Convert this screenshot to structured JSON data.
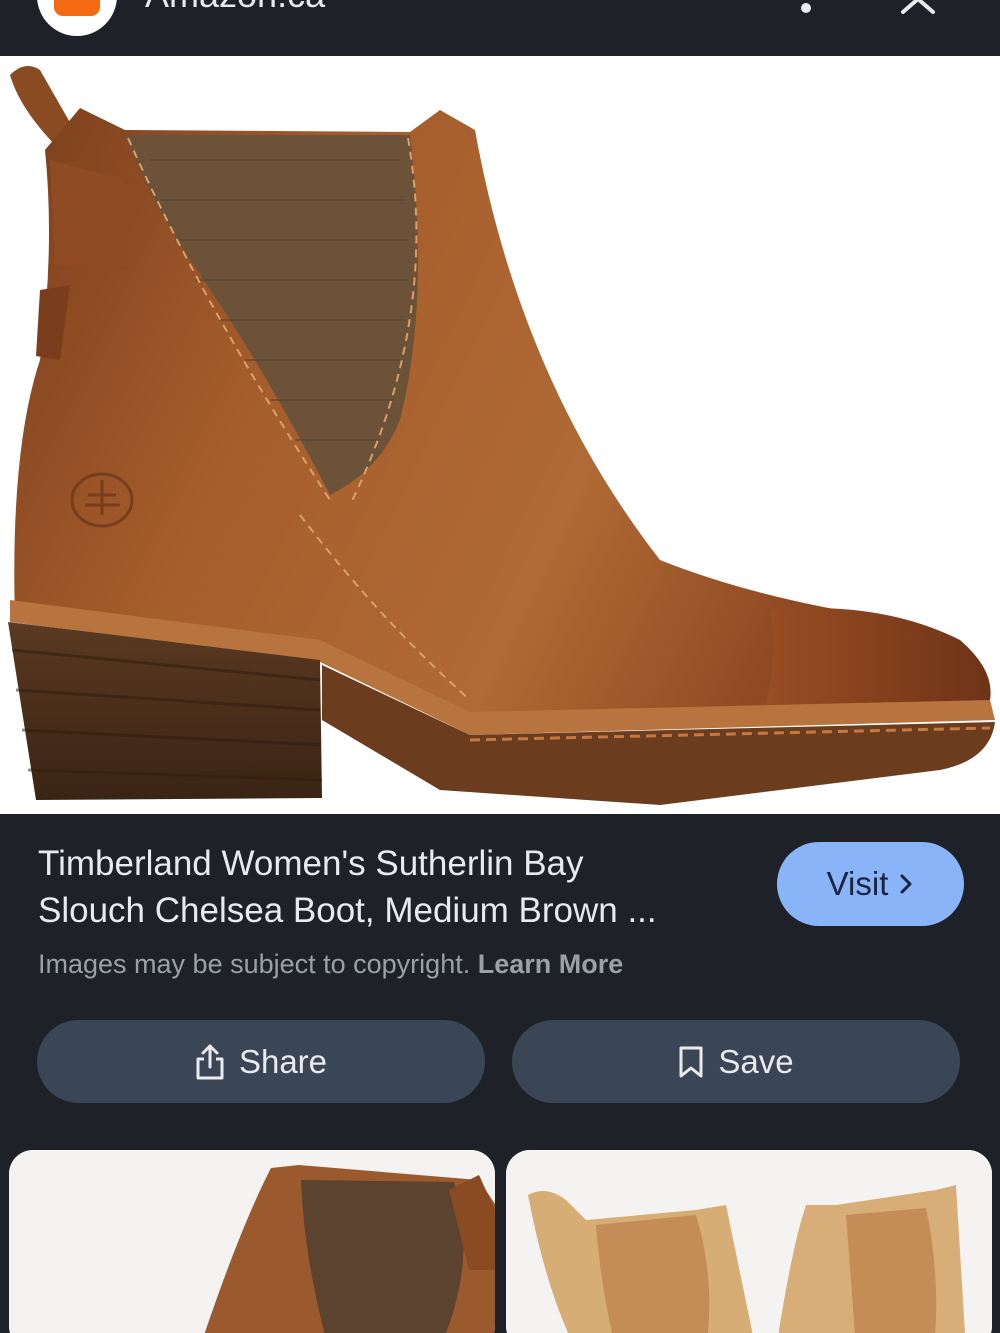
{
  "header": {
    "site_name": "Amazon.ca",
    "site_icon": "amazon-favicon",
    "more_icon": "more-vertical-icon",
    "close_icon": "close-icon"
  },
  "result": {
    "title_line1": "Timberland Women's Sutherlin Bay",
    "title_line2": "Slouch Chelsea Boot, Medium Brown ...",
    "visit_label": "Visit",
    "copyright_text": "Images may be subject to copyright.",
    "learn_more_label": "Learn More"
  },
  "actions": {
    "share_label": "Share",
    "share_icon": "share-icon",
    "save_label": "Save",
    "save_icon": "bookmark-icon"
  },
  "colors": {
    "background": "#1f2128",
    "visit_button": "#8ab4f8",
    "action_button": "#3a4556",
    "site_icon": "#f46a12"
  }
}
